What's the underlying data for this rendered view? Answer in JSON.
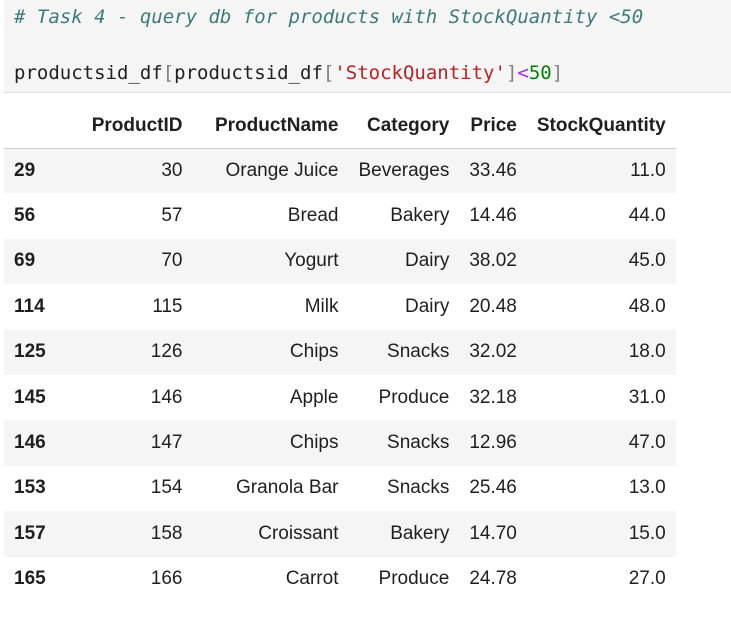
{
  "code": {
    "comment": "# Task 4 - query db for products with StockQuantity <50",
    "tokens": {
      "var1": "productsid_df",
      "open1": "[",
      "var2": "productsid_df",
      "open2": "[",
      "string": "'StockQuantity'",
      "close2": "]",
      "op": "<",
      "num": "50",
      "close1": "]"
    }
  },
  "table": {
    "columns": [
      "ProductID",
      "ProductName",
      "Category",
      "Price",
      "StockQuantity"
    ],
    "rows": [
      {
        "index": "29",
        "cells": [
          "30",
          "Orange Juice",
          "Beverages",
          "33.46",
          "11.0"
        ]
      },
      {
        "index": "56",
        "cells": [
          "57",
          "Bread",
          "Bakery",
          "14.46",
          "44.0"
        ]
      },
      {
        "index": "69",
        "cells": [
          "70",
          "Yogurt",
          "Dairy",
          "38.02",
          "45.0"
        ]
      },
      {
        "index": "114",
        "cells": [
          "115",
          "Milk",
          "Dairy",
          "20.48",
          "48.0"
        ]
      },
      {
        "index": "125",
        "cells": [
          "126",
          "Chips",
          "Snacks",
          "32.02",
          "18.0"
        ]
      },
      {
        "index": "145",
        "cells": [
          "146",
          "Apple",
          "Produce",
          "32.18",
          "31.0"
        ]
      },
      {
        "index": "146",
        "cells": [
          "147",
          "Chips",
          "Snacks",
          "12.96",
          "47.0"
        ]
      },
      {
        "index": "153",
        "cells": [
          "154",
          "Granola Bar",
          "Snacks",
          "25.46",
          "13.0"
        ]
      },
      {
        "index": "157",
        "cells": [
          "158",
          "Croissant",
          "Bakery",
          "14.70",
          "15.0"
        ]
      },
      {
        "index": "165",
        "cells": [
          "166",
          "Carrot",
          "Produce",
          "24.78",
          "27.0"
        ]
      }
    ]
  }
}
